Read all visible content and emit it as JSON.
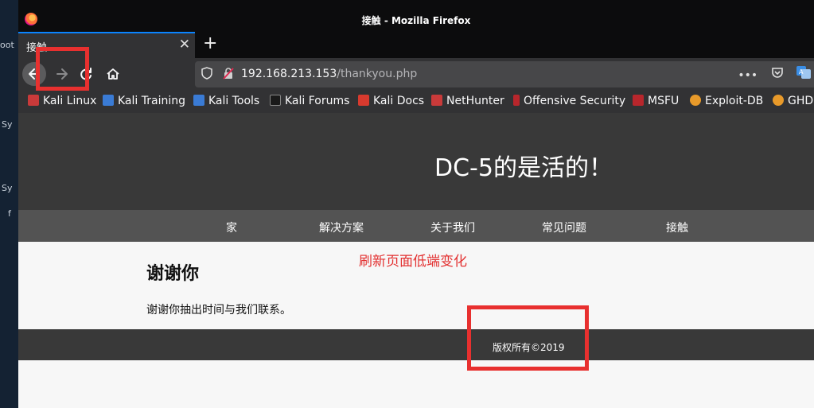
{
  "desktop": {
    "side_labels": [
      "oot",
      "Sy",
      "Sy",
      "f"
    ]
  },
  "window": {
    "title": "接触 - Mozilla Firefox"
  },
  "tab": {
    "label": "接触",
    "close_glyph": "✕",
    "newtab_glyph": "+"
  },
  "nav": {
    "back_icon": "back-arrow-icon",
    "forward_icon": "forward-arrow-icon",
    "reload_icon": "reload-icon",
    "home_icon": "home-icon"
  },
  "url": {
    "host": "192.168.213.153",
    "path": "/thankyou.php"
  },
  "bookmarks": [
    {
      "label": "Kali Linux",
      "color": "#c93a3a"
    },
    {
      "label": "Kali Training",
      "color": "#3a7bd5"
    },
    {
      "label": "Kali Tools",
      "color": "#3a7bd5"
    },
    {
      "label": "Kali Forums",
      "color": "#1a1a1a"
    },
    {
      "label": "Kali Docs",
      "color": "#d83a2e"
    },
    {
      "label": "NetHunter",
      "color": "#c93a3a"
    },
    {
      "label": "Offensive Security",
      "color": "#b8262c"
    },
    {
      "label": "MSFU",
      "color": "#b8262c"
    },
    {
      "label": "Exploit-DB",
      "color": "#e89a2a"
    },
    {
      "label": "GHD",
      "color": "#e89a2a"
    }
  ],
  "site": {
    "title": "DC-5的是活的！",
    "nav": [
      "家",
      "解决方案",
      "关于我们",
      "常见问题",
      "接触"
    ],
    "heading": "谢谢你",
    "text": "谢谢你抽出时间与我们联系。",
    "footer": "版权所有©2019"
  },
  "annotation": {
    "text": "刷新页面低端变化",
    "color": "#e33030"
  }
}
